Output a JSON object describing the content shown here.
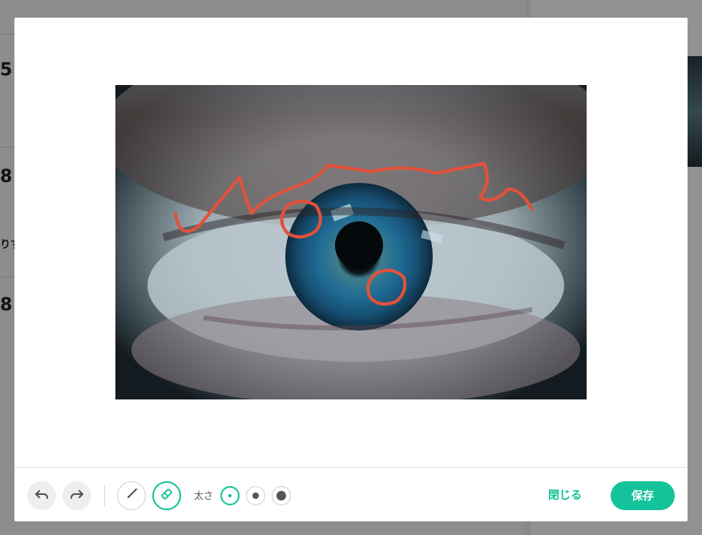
{
  "background": {
    "numbers": [
      "5",
      "8",
      "8"
    ],
    "snippet": "りす"
  },
  "toolbar": {
    "undo_icon": "undo-icon",
    "redo_icon": "redo-icon",
    "brush_icon": "brush-icon",
    "eraser_icon": "eraser-icon",
    "size_label": "太さ",
    "size_selected": "small",
    "close_label": "閉じる",
    "save_label": "保存"
  },
  "colors": {
    "accent": "#15c39a",
    "stroke": "#e2523a"
  }
}
